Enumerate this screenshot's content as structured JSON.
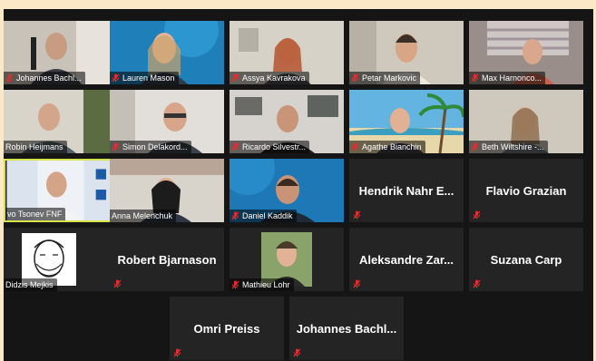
{
  "colors": {
    "background": "#fbe8c6",
    "gallery": "#151515",
    "tile": "#242424",
    "active_border": "#d7e34a",
    "muted": "#e0302e"
  },
  "participants": [
    {
      "name": "Johannes Bachl...",
      "video": true,
      "muted": true
    },
    {
      "name": "Lauren Mason",
      "video": true,
      "muted": true
    },
    {
      "name": "Assya Kavrakova",
      "video": true,
      "muted": true
    },
    {
      "name": "Petar Markovic",
      "video": true,
      "muted": true
    },
    {
      "name": "Max Harnonco...",
      "video": true,
      "muted": true
    },
    {
      "name": "Robin Heijmans",
      "video": true,
      "muted": false
    },
    {
      "name": "Simon Delakord...",
      "video": true,
      "muted": true
    },
    {
      "name": "Ricardo Silvestr...",
      "video": true,
      "muted": true
    },
    {
      "name": "Agathe Bianchin",
      "video": true,
      "muted": true
    },
    {
      "name": "Beth Wiltshire -...",
      "video": true,
      "muted": true
    },
    {
      "name": "vo Tsonev FNF",
      "video": true,
      "muted": false,
      "active_speaker": true
    },
    {
      "name": "Anna Melenchuk",
      "video": true,
      "muted": false
    },
    {
      "name": "Daniel Kaddik",
      "video": true,
      "muted": true
    },
    {
      "name": "Hendrik Nahr E...",
      "video": false,
      "muted": true
    },
    {
      "name": "Flavio Grazian",
      "video": false,
      "muted": true
    },
    {
      "name": "Didzis Mejkis",
      "video": true,
      "muted": false
    },
    {
      "name": "Robert Bjarnason",
      "video": false,
      "muted": true
    },
    {
      "name": "Mathieu Lohr",
      "video": true,
      "muted": true,
      "thumbnail": true
    },
    {
      "name": "Aleksandre Zar...",
      "video": false,
      "muted": true
    },
    {
      "name": "Suzana Carp",
      "video": false,
      "muted": true
    },
    {
      "name": "Omri Preiss",
      "video": false,
      "muted": true
    },
    {
      "name": "Johannes Bachl...",
      "video": false,
      "muted": true
    }
  ]
}
